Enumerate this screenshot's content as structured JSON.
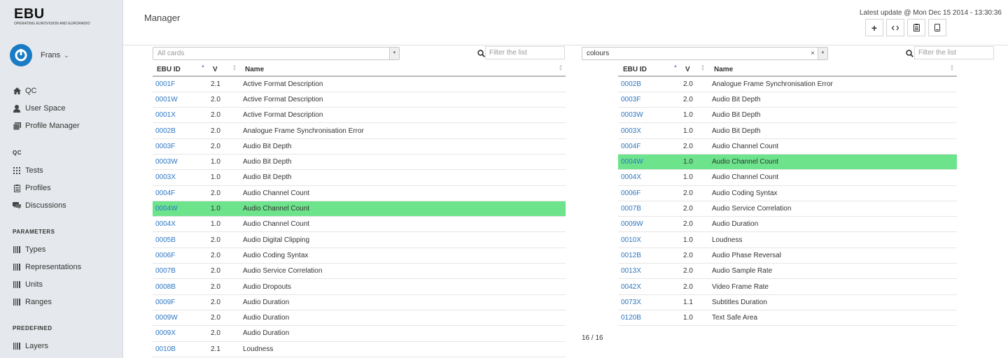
{
  "logo": {
    "main": "EBU",
    "sub": "OPERATING EUROVISION AND EURORADIO"
  },
  "user": {
    "name": "Frans"
  },
  "nav": {
    "top": [
      {
        "label": "QC",
        "icon": "home-icon"
      },
      {
        "label": "User Space",
        "icon": "user-icon"
      },
      {
        "label": "Profile Manager",
        "icon": "documents-icon"
      }
    ],
    "sections": [
      {
        "title": "QC",
        "items": [
          {
            "label": "Tests",
            "icon": "grid-icon"
          },
          {
            "label": "Profiles",
            "icon": "clipboard-icon"
          },
          {
            "label": "Discussions",
            "icon": "comments-icon"
          }
        ]
      },
      {
        "title": "PARAMETERS",
        "items": [
          {
            "label": "Types",
            "icon": "barcode-icon"
          },
          {
            "label": "Representations",
            "icon": "barcode-icon"
          },
          {
            "label": "Units",
            "icon": "barcode-icon"
          },
          {
            "label": "Ranges",
            "icon": "barcode-icon"
          }
        ]
      },
      {
        "title": "PREDEFINED",
        "items": [
          {
            "label": "Layers",
            "icon": "barcode-icon"
          }
        ]
      }
    ]
  },
  "header": {
    "title": "Manager",
    "last_update": "Latest update @ Mon Dec 15 2014 - 13:30:36",
    "toolbar": [
      {
        "name": "add-button",
        "glyph": "+"
      },
      {
        "name": "code-button",
        "glyph": "‹›"
      },
      {
        "name": "clipboard-button",
        "glyph": "📋"
      },
      {
        "name": "copy-button",
        "glyph": "▯"
      }
    ]
  },
  "left_panel": {
    "select_placeholder": "All cards",
    "filter_placeholder": "Filter the list",
    "columns": [
      "EBU ID",
      "V",
      "Name"
    ],
    "highlight_color": "#6de38c",
    "rows": [
      {
        "id": "0001F",
        "v": "2.1",
        "name": "Active Format Description"
      },
      {
        "id": "0001W",
        "v": "2.0",
        "name": "Active Format Description"
      },
      {
        "id": "0001X",
        "v": "2.0",
        "name": "Active Format Description"
      },
      {
        "id": "0002B",
        "v": "2.0",
        "name": "Analogue Frame Synchronisation Error"
      },
      {
        "id": "0003F",
        "v": "2.0",
        "name": "Audio Bit Depth"
      },
      {
        "id": "0003W",
        "v": "1.0",
        "name": "Audio Bit Depth"
      },
      {
        "id": "0003X",
        "v": "1.0",
        "name": "Audio Bit Depth"
      },
      {
        "id": "0004F",
        "v": "2.0",
        "name": "Audio Channel Count"
      },
      {
        "id": "0004W",
        "v": "1.0",
        "name": "Audio Channel Count",
        "highlight": true
      },
      {
        "id": "0004X",
        "v": "1.0",
        "name": "Audio Channel Count"
      },
      {
        "id": "0005B",
        "v": "2.0",
        "name": "Audio Digital Clipping"
      },
      {
        "id": "0006F",
        "v": "2.0",
        "name": "Audio Coding Syntax"
      },
      {
        "id": "0007B",
        "v": "2.0",
        "name": "Audio Service Correlation"
      },
      {
        "id": "0008B",
        "v": "2.0",
        "name": "Audio Dropouts"
      },
      {
        "id": "0009F",
        "v": "2.0",
        "name": "Audio Duration"
      },
      {
        "id": "0009W",
        "v": "2.0",
        "name": "Audio Duration"
      },
      {
        "id": "0009X",
        "v": "2.0",
        "name": "Audio Duration"
      },
      {
        "id": "0010B",
        "v": "2.1",
        "name": "Loudness"
      }
    ]
  },
  "right_panel": {
    "select_value": "colours",
    "clear_glyph": "×",
    "filter_placeholder": "Filter the list",
    "columns": [
      "EBU ID",
      "V",
      "Name"
    ],
    "count": "16 / 16",
    "rows": [
      {
        "id": "0002B",
        "v": "2.0",
        "name": "Analogue Frame Synchronisation Error"
      },
      {
        "id": "0003F",
        "v": "2.0",
        "name": "Audio Bit Depth"
      },
      {
        "id": "0003W",
        "v": "1.0",
        "name": "Audio Bit Depth"
      },
      {
        "id": "0003X",
        "v": "1.0",
        "name": "Audio Bit Depth"
      },
      {
        "id": "0004F",
        "v": "2.0",
        "name": "Audio Channel Count"
      },
      {
        "id": "0004W",
        "v": "1.0",
        "name": "Audio Channel Count",
        "highlight": true
      },
      {
        "id": "0004X",
        "v": "1.0",
        "name": "Audio Channel Count"
      },
      {
        "id": "0006F",
        "v": "2.0",
        "name": "Audio Coding Syntax"
      },
      {
        "id": "0007B",
        "v": "2.0",
        "name": "Audio Service Correlation"
      },
      {
        "id": "0009W",
        "v": "2.0",
        "name": "Audio Duration"
      },
      {
        "id": "0010X",
        "v": "1.0",
        "name": "Loudness"
      },
      {
        "id": "0012B",
        "v": "2.0",
        "name": "Audio Phase Reversal"
      },
      {
        "id": "0013X",
        "v": "2.0",
        "name": "Audio Sample Rate"
      },
      {
        "id": "0042X",
        "v": "2.0",
        "name": "Video Frame Rate"
      },
      {
        "id": "0073X",
        "v": "1.1",
        "name": "Subtitles Duration"
      },
      {
        "id": "0120B",
        "v": "1.0",
        "name": "Text Safe Area"
      }
    ]
  }
}
